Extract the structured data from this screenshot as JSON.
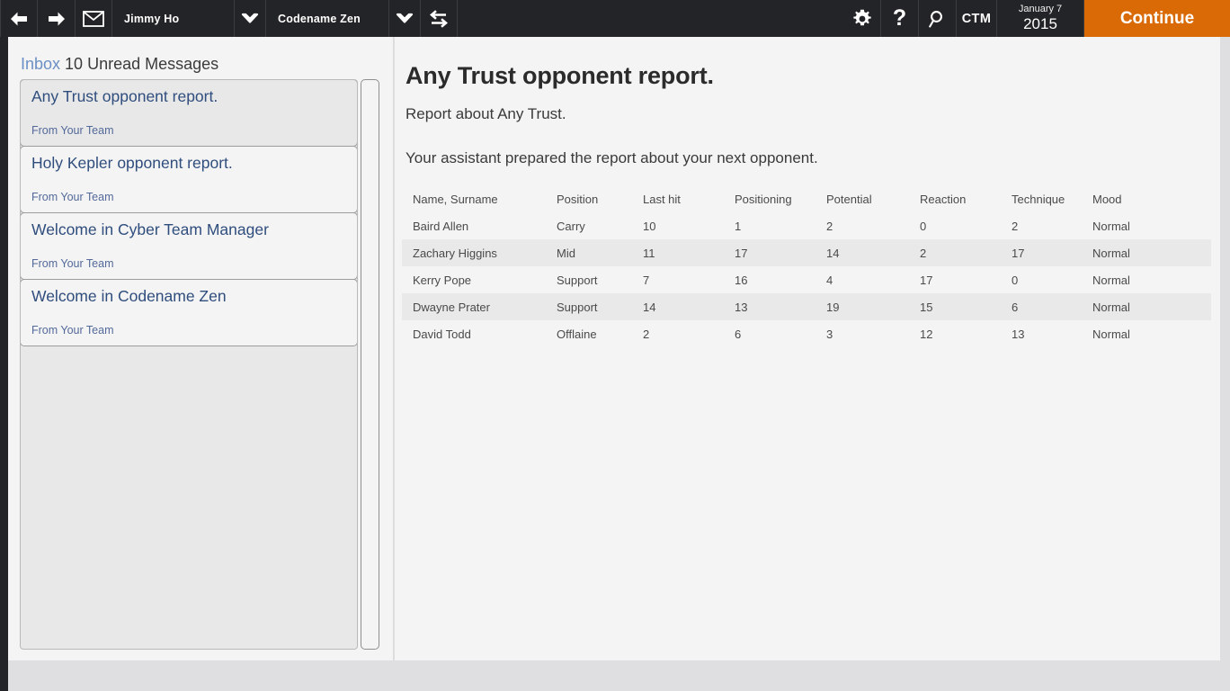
{
  "topbar": {
    "back_icon": "arrow-left-icon",
    "forward_icon": "arrow-right-icon",
    "mail_icon": "envelope-icon",
    "manager_name": "Jimmy Ho",
    "manager_caret": "chevron-down-icon",
    "team_name": "Codename Zen",
    "team_caret": "chevron-down-icon",
    "swap_icon": "swap-arrows-icon",
    "settings_icon": "gear-icon",
    "help_icon": "question-mark-icon",
    "search_icon": "magnifier-icon",
    "ctm_label": "CTM",
    "date_day": "January 7",
    "date_year": "2015",
    "continue_label": "Continue"
  },
  "inbox": {
    "header_keyword": "Inbox",
    "header_rest": " 10 Unread Messages",
    "messages": [
      {
        "title": "Any Trust opponent report.",
        "from": "From Your Team",
        "selected": true
      },
      {
        "title": "Holy Kepler opponent report.",
        "from": "From Your Team",
        "selected": false
      },
      {
        "title": "Welcome in Cyber Team Manager",
        "from": "From Your Team",
        "selected": false
      },
      {
        "title": "Welcome in Codename Zen",
        "from": "From Your Team",
        "selected": false
      }
    ]
  },
  "report": {
    "title": "Any Trust opponent report.",
    "subtitle": "Report about Any Trust.",
    "intro": "Your assistant prepared the report about your next opponent.",
    "columns": [
      "Name, Surname",
      "Position",
      "Last hit",
      "Positioning",
      "Potential",
      "Reaction",
      "Technique",
      "Mood"
    ],
    "rows": [
      [
        "Baird Allen",
        "Carry",
        "10",
        "1",
        "2",
        "0",
        "2",
        "Normal"
      ],
      [
        "Zachary Higgins",
        "Mid",
        "11",
        "17",
        "14",
        "2",
        "17",
        "Normal"
      ],
      [
        "Kerry Pope",
        "Support",
        "7",
        "16",
        "4",
        "17",
        "0",
        "Normal"
      ],
      [
        "Dwayne Prater",
        "Support",
        "14",
        "13",
        "19",
        "15",
        "6",
        "Normal"
      ],
      [
        "David Todd",
        "Offlaine",
        "2",
        "6",
        "3",
        "12",
        "13",
        "Normal"
      ]
    ]
  },
  "colors": {
    "topbar_bg": "#232427",
    "accent_orange": "#d96a05",
    "link_blue": "#2f4d7d",
    "muted_blue": "#53699a"
  }
}
